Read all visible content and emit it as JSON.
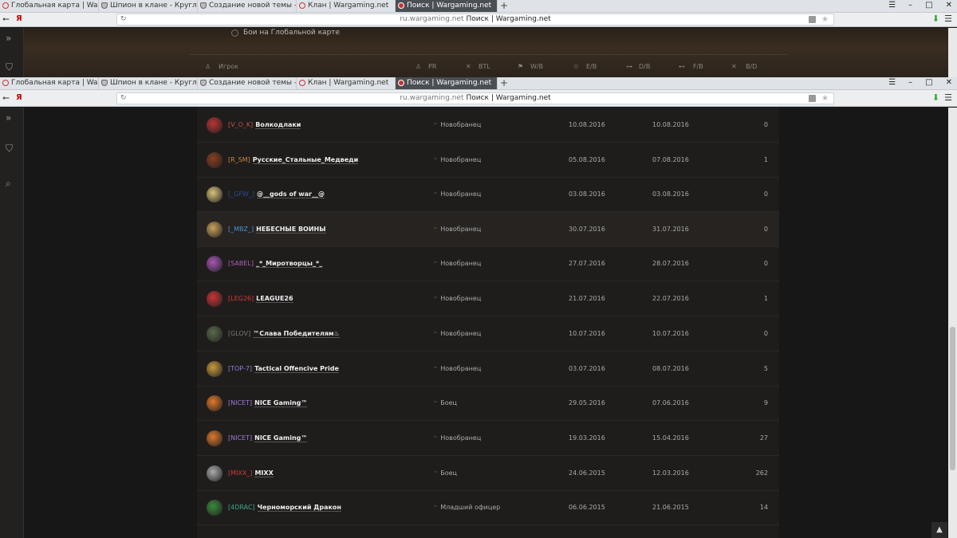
{
  "tabs": [
    {
      "label": "Глобальная карта | Wargam",
      "icon": "wot-icon"
    },
    {
      "label": "Шпион в клане - Круглый",
      "icon": "shield-icon"
    },
    {
      "label": "Создание новой темы - Оф",
      "icon": "shield-icon"
    },
    {
      "label": "Клан | Wargaming.net",
      "icon": "wot-icon"
    },
    {
      "label": "Поиск | Wargaming.net",
      "icon": "wot-icon",
      "active": true
    }
  ],
  "browser": {
    "ya": "Я",
    "url_domain": "ru.wargaming.net",
    "url_title": "Поиск | Wargaming.net"
  },
  "top_section": {
    "radio_label": "Бои на Глобальной карте",
    "header": {
      "player": "Игрок",
      "pr": "PR",
      "btl": "BTL",
      "wb": "W/B",
      "eb": "E/B",
      "db": "D/B",
      "fb": "F/B",
      "bd": "B/D"
    }
  },
  "clans": [
    {
      "tag": "[V_O_K]",
      "name": "Волкодлаки",
      "tag_color": "#c0504d",
      "role": "Новобранец",
      "date_join": "10.08.2016",
      "date_leave": "10.08.2016",
      "battles": "0",
      "emblem_color": "#b33"
    },
    {
      "tag": "[R_SM]",
      "name": "Русские_Стальные_Медведи",
      "tag_color": "#c58a3a",
      "role": "Новобранец",
      "date_join": "05.08.2016",
      "date_leave": "07.08.2016",
      "battles": "1",
      "emblem_color": "#8a3d20"
    },
    {
      "tag": "[_GFW_]",
      "name": "@__gods of war__@",
      "tag_color": "#2a4a9a",
      "role": "Новобранец",
      "date_join": "03.08.2016",
      "date_leave": "03.08.2016",
      "battles": "0",
      "emblem_color": "#d9c27a"
    },
    {
      "tag": "[_MBZ_]",
      "name": "НЕБЕСНЫЕ ВОИНЫ",
      "tag_color": "#4a8fd6",
      "role": "Новобранец",
      "date_join": "30.07.2016",
      "date_leave": "31.07.2016",
      "battles": "0",
      "emblem_color": "#c9a25a"
    },
    {
      "tag": "[SABEL]",
      "name": "_*_Миротворцы_*_",
      "tag_color": "#b05ab8",
      "role": "Новобранец",
      "date_join": "27.07.2016",
      "date_leave": "28.07.2016",
      "battles": "0",
      "emblem_color": "#a855b5"
    },
    {
      "tag": "[LEG26]",
      "name": "LEAGUE26",
      "tag_color": "#d23a3a",
      "role": "Новобранец",
      "date_join": "21.07.2016",
      "date_leave": "22.07.2016",
      "battles": "1",
      "emblem_color": "#c33"
    },
    {
      "tag": "[GLOV]",
      "name": "™Слава Победителям♨",
      "tag_color": "#777777",
      "role": "Новобранец",
      "date_join": "10.07.2016",
      "date_leave": "10.07.2016",
      "battles": "0",
      "emblem_color": "#5a6a4a"
    },
    {
      "tag": "[TOP-7]",
      "name": "Tactical Offencive Pride",
      "tag_color": "#9a7ad6",
      "role": "Новобранец",
      "date_join": "03.07.2016",
      "date_leave": "08.07.2016",
      "battles": "5",
      "emblem_color": "#c89a3a"
    },
    {
      "tag": "[NICET]",
      "name": "NICE Gaming™",
      "tag_color": "#9a7ad6",
      "role": "Боец",
      "date_join": "29.05.2016",
      "date_leave": "07.06.2016",
      "battles": "9",
      "emblem_color": "#e0782a"
    },
    {
      "tag": "[NICET]",
      "name": "NICE Gaming™",
      "tag_color": "#9a7ad6",
      "role": "Новобранец",
      "date_join": "19.03.2016",
      "date_leave": "15.04.2016",
      "battles": "27",
      "emblem_color": "#e0782a"
    },
    {
      "tag": "[MIXX_]",
      "name": "MIXX",
      "tag_color": "#d23a3a",
      "role": "Боец",
      "date_join": "24.06.2015",
      "date_leave": "12.03.2016",
      "battles": "262",
      "emblem_color": "#aaa"
    },
    {
      "tag": "[4DRAC]",
      "name": "Черноморский Дракон",
      "tag_color": "#3aa88a",
      "role": "Младший офицер",
      "date_join": "06.06.2015",
      "date_leave": "21.06.2015",
      "battles": "14",
      "emblem_color": "#3a8a3a"
    }
  ]
}
